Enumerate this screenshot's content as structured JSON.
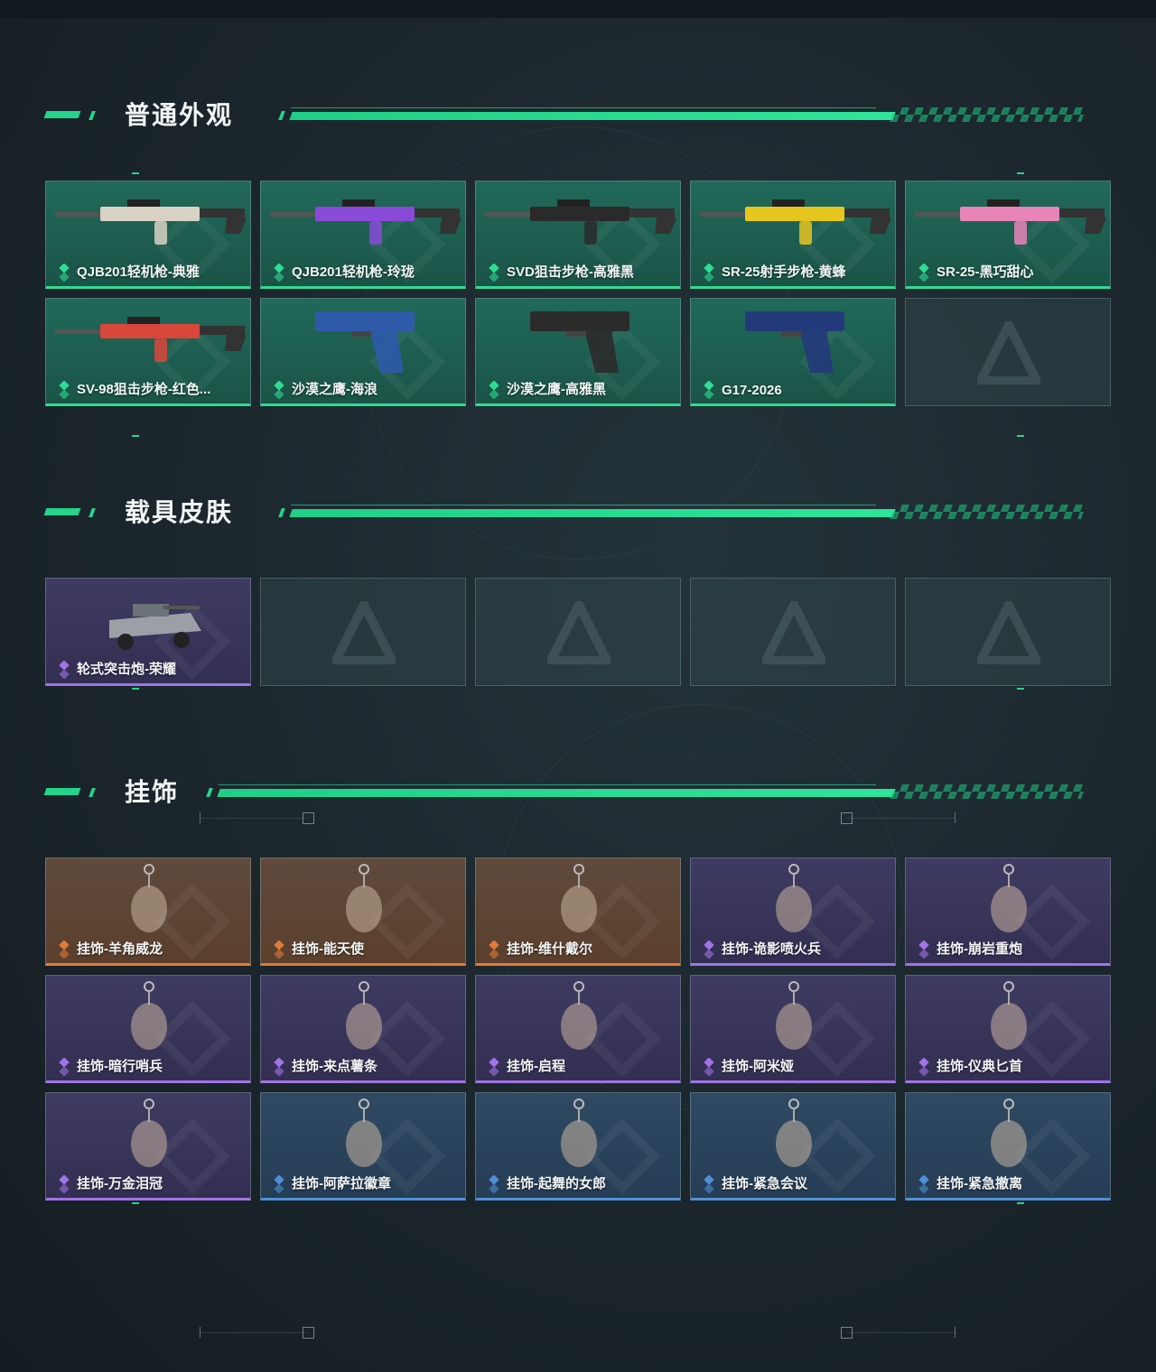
{
  "sections": [
    {
      "title": "普通外观",
      "cards": [
        {
          "label": "QJB201轻机枪-典雅",
          "rarity": "green",
          "icon": "lmg-weapon-icon"
        },
        {
          "label": "QJB201轻机枪-玲珑",
          "rarity": "green",
          "icon": "lmg-weapon-icon"
        },
        {
          "label": "SVD狙击步枪-高雅黑",
          "rarity": "green",
          "icon": "sniper-rifle-icon"
        },
        {
          "label": "SR-25射手步枪-黄蜂",
          "rarity": "green",
          "icon": "marksman-rifle-icon"
        },
        {
          "label": "SR-25-黑巧甜心",
          "rarity": "green",
          "icon": "marksman-rifle-icon"
        },
        {
          "label": "SV-98狙击步枪-红色...",
          "rarity": "green",
          "icon": "sniper-rifle-icon"
        },
        {
          "label": "沙漠之鹰-海浪",
          "rarity": "green",
          "icon": "pistol-icon"
        },
        {
          "label": "沙漠之鹰-高雅黑",
          "rarity": "green",
          "icon": "pistol-icon"
        },
        {
          "label": "G17-2026",
          "rarity": "green",
          "icon": "pistol-icon"
        },
        {
          "label": "",
          "rarity": "empty",
          "icon": "empty-slot-logo-icon"
        }
      ]
    },
    {
      "title": "载具皮肤",
      "cards": [
        {
          "label": "轮式突击炮-荣耀",
          "rarity": "purple",
          "icon": "vehicle-icon"
        },
        {
          "label": "",
          "rarity": "empty",
          "icon": "empty-slot-logo-icon"
        },
        {
          "label": "",
          "rarity": "empty",
          "icon": "empty-slot-logo-icon"
        },
        {
          "label": "",
          "rarity": "empty",
          "icon": "empty-slot-logo-icon"
        },
        {
          "label": "",
          "rarity": "empty",
          "icon": "empty-slot-logo-icon"
        }
      ]
    },
    {
      "title": "挂饰",
      "cards": [
        {
          "label": "挂饰-羊角威龙",
          "rarity": "orange",
          "icon": "charm-icon"
        },
        {
          "label": "挂饰-能天使",
          "rarity": "orange",
          "icon": "charm-icon"
        },
        {
          "label": "挂饰-维什戴尔",
          "rarity": "orange",
          "icon": "charm-icon"
        },
        {
          "label": "挂饰-诡影喷火兵",
          "rarity": "purple",
          "icon": "charm-icon"
        },
        {
          "label": "挂饰-崩岩重炮",
          "rarity": "purple",
          "icon": "charm-icon"
        },
        {
          "label": "挂饰-暗行哨兵",
          "rarity": "purple",
          "icon": "charm-icon"
        },
        {
          "label": "挂饰-来点薯条",
          "rarity": "purple",
          "icon": "charm-icon"
        },
        {
          "label": "挂饰-启程",
          "rarity": "purple",
          "icon": "charm-icon"
        },
        {
          "label": "挂饰-阿米娅",
          "rarity": "purple",
          "icon": "charm-icon"
        },
        {
          "label": "挂饰-仪典匕首",
          "rarity": "purple",
          "icon": "charm-icon"
        },
        {
          "label": "挂饰-万金泪冠",
          "rarity": "purple",
          "icon": "charm-icon"
        },
        {
          "label": "挂饰-阿萨拉徽章",
          "rarity": "blue",
          "icon": "charm-icon"
        },
        {
          "label": "挂饰-起舞的女郎",
          "rarity": "blue",
          "icon": "charm-icon"
        },
        {
          "label": "挂饰-紧急会议",
          "rarity": "blue",
          "icon": "charm-icon"
        },
        {
          "label": "挂饰-紧急撤离",
          "rarity": "blue",
          "icon": "charm-icon"
        }
      ]
    }
  ],
  "colors": {
    "accent": "#25d48c",
    "green": "#2edc93",
    "purple": "#a173e6",
    "orange": "#e07b3a",
    "blue": "#4f8fd6"
  }
}
